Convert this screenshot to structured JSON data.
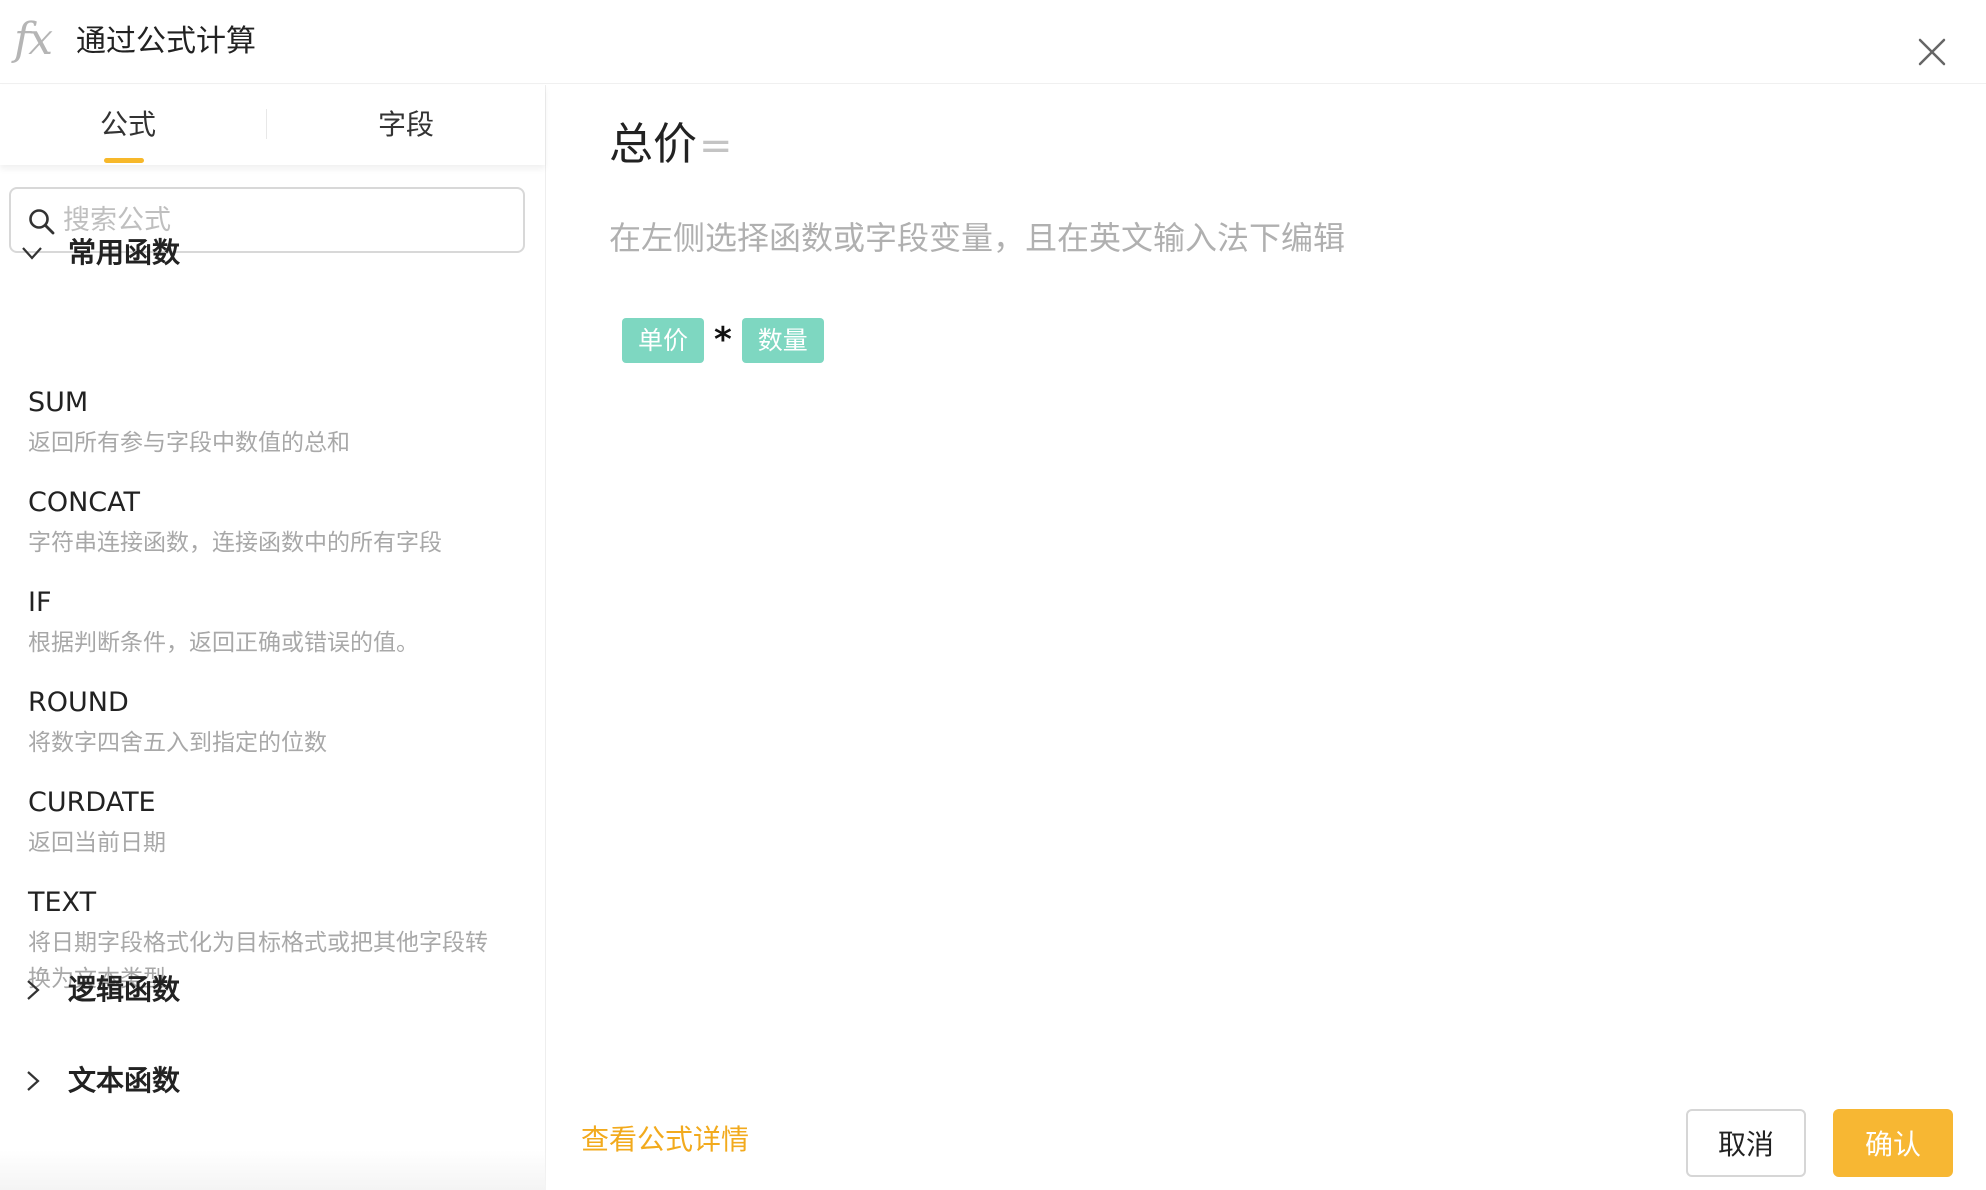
{
  "header": {
    "icon_text": "fx",
    "title": "通过公式计算",
    "close_icon": "close-icon"
  },
  "tabs": [
    {
      "label": "公式",
      "active": true
    },
    {
      "label": "字段",
      "active": false
    }
  ],
  "search": {
    "placeholder": "搜索公式",
    "value": ""
  },
  "groups": [
    {
      "title": "常用函数",
      "expanded": true,
      "items": [
        {
          "name": "SUM",
          "desc": "返回所有参与字段中数值的总和"
        },
        {
          "name": "CONCAT",
          "desc": "字符串连接函数，连接函数中的所有字段"
        },
        {
          "name": "IF",
          "desc": "根据判断条件，返回正确或错误的值。"
        },
        {
          "name": "ROUND",
          "desc": "将数字四舍五入到指定的位数"
        },
        {
          "name": "CURDATE",
          "desc": "返回当前日期"
        },
        {
          "name": "TEXT",
          "desc": "将日期字段格式化为目标格式或把其他字段转换为文本类型"
        }
      ]
    },
    {
      "title": "逻辑函数",
      "expanded": false
    },
    {
      "title": "文本函数",
      "expanded": false
    }
  ],
  "editor": {
    "field_name": "总价",
    "equals": "=",
    "hint": "在左侧选择函数或字段变量，且在英文输入法下编辑",
    "expression": [
      {
        "type": "field",
        "text": "单价"
      },
      {
        "type": "operator",
        "text": "*"
      },
      {
        "type": "field",
        "text": "数量"
      }
    ]
  },
  "footer": {
    "details_link": "查看公式详情",
    "cancel_label": "取消",
    "confirm_label": "确认"
  },
  "colors": {
    "accent": "#f7b733",
    "link": "#f2aa1d",
    "chip": "#7ed7c1",
    "muted_text": "#a8a8a8"
  }
}
